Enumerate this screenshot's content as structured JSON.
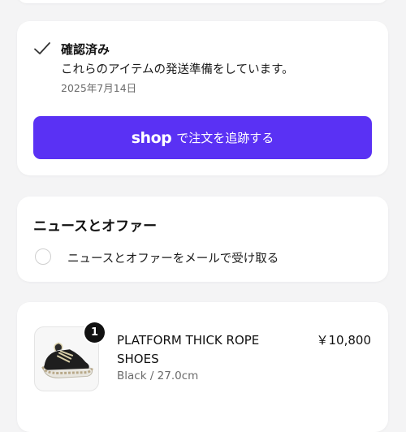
{
  "status": {
    "title": "確認済み",
    "message": "これらのアイテムの発送準備をしています。",
    "date": "2025年7月14日"
  },
  "track_button": {
    "logo": "shop",
    "label": "で注文を追跡する",
    "color": "#5a31f4"
  },
  "news": {
    "title": "ニュースとオファー",
    "checkbox_label": "ニュースとオファーをメールで受け取る",
    "checked": false
  },
  "order_item": {
    "quantity": "1",
    "name": "PLATFORM THICK ROPE SHOES",
    "variant": "Black / 27.0cm",
    "price": "￥10,800",
    "image_icon": "shoe-icon"
  }
}
